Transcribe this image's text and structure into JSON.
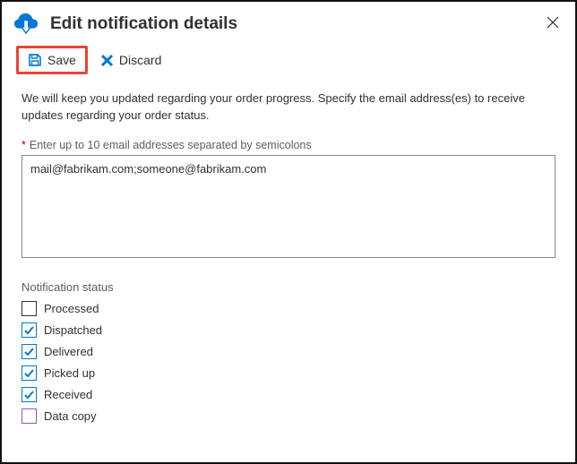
{
  "header": {
    "title": "Edit notification details"
  },
  "toolbar": {
    "save_label": "Save",
    "discard_label": "Discard"
  },
  "description": "We will keep you updated regarding your order progress. Specify the email address(es) to receive updates regarding your order status.",
  "email_field": {
    "label": "Enter up to 10 email addresses separated by semicolons",
    "value": "mail@fabrikam.com;someone@fabrikam.com"
  },
  "notification_status": {
    "label": "Notification status",
    "items": [
      {
        "label": "Processed",
        "checked": false
      },
      {
        "label": "Dispatched",
        "checked": true
      },
      {
        "label": "Delivered",
        "checked": true
      },
      {
        "label": "Picked up",
        "checked": true
      },
      {
        "label": "Received",
        "checked": true
      },
      {
        "label": "Data copy",
        "checked": false,
        "accent": "special"
      }
    ]
  },
  "colors": {
    "primary": "#0078d4",
    "highlight": "#e8443a"
  }
}
